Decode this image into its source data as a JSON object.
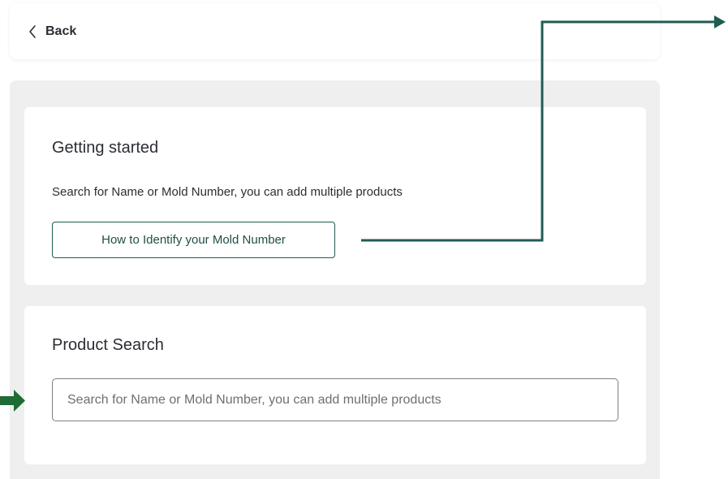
{
  "header": {
    "back_label": "Back"
  },
  "getting_started": {
    "title": "Getting started",
    "description": "Search for Name or Mold Number, you can add multiple products",
    "identify_button_label": "How to Identify your Mold Number"
  },
  "product_search": {
    "title": "Product Search",
    "input_placeholder": "Search for Name or Mold Number, you can add multiple products",
    "input_value": ""
  },
  "icons": {
    "back": "chevron-left-icon",
    "callout_connector": "arrow-right-icon",
    "input_pointer": "arrow-right-icon"
  },
  "colors": {
    "accent": "#1f5c52",
    "pointer_arrow": "#1e6b35",
    "panel_bg": "#efefef"
  }
}
